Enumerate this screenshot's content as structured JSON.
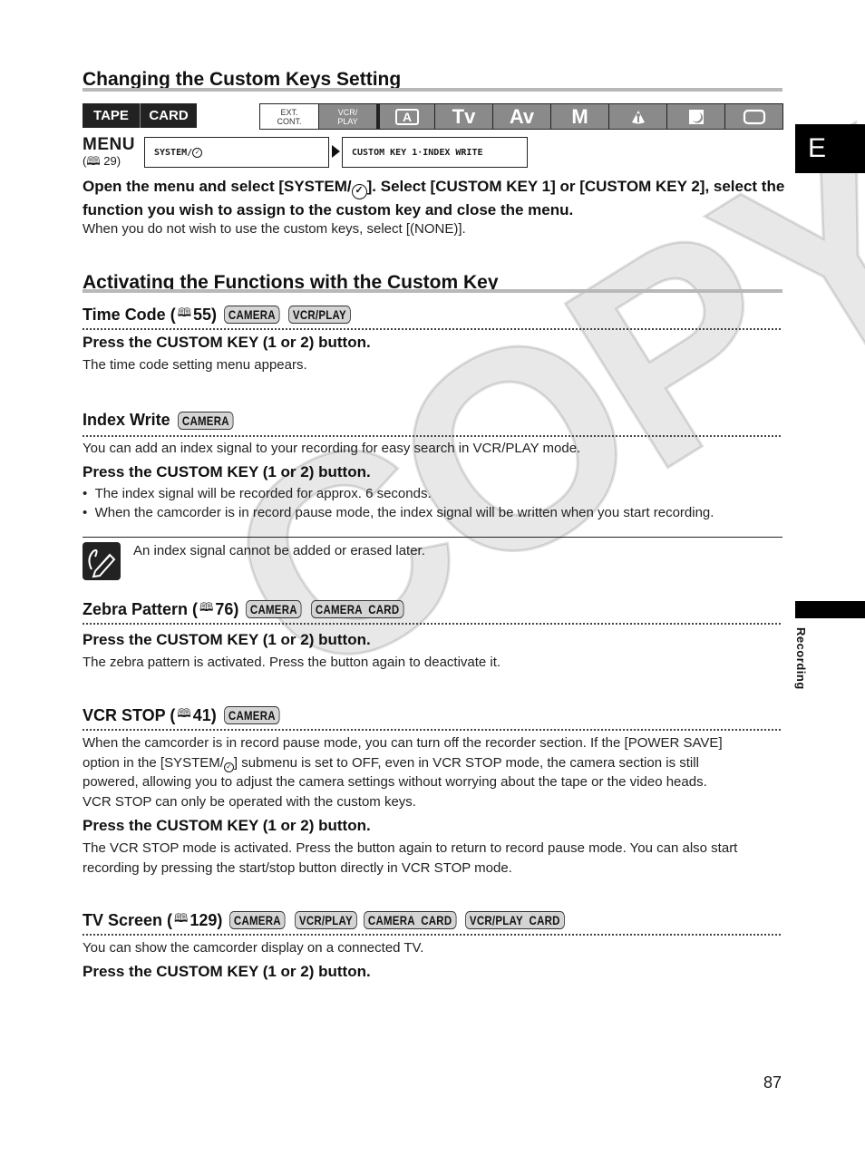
{
  "section1": {
    "title": "Changing the Custom Keys Setting",
    "media_modes": [
      "TAPE",
      "CARD"
    ],
    "shooting_modes": [
      {
        "label": "EXT.\nCONT.",
        "name": "ext-cont",
        "active": true
      },
      {
        "label": "VCR/\nPLAY",
        "name": "vcr-play",
        "active": false
      },
      {
        "label": "A",
        "name": "auto",
        "active": false
      },
      {
        "label": "Tv",
        "name": "tv",
        "active": false
      },
      {
        "label": "Av",
        "name": "av",
        "active": false
      },
      {
        "label": "M",
        "name": "manual",
        "active": false
      },
      {
        "label": "spotlight",
        "name": "spotlight",
        "active": false
      },
      {
        "label": "night",
        "name": "night",
        "active": false
      },
      {
        "label": "scene",
        "name": "scene",
        "active": false
      }
    ],
    "menu_label": "MENU",
    "menu_ref": "29",
    "menu_path_1": "SYSTEM/",
    "menu_path_2": "CUSTOM KEY 1·INDEX WRITE",
    "instruction": "Open the menu and select [SYSTEM/",
    "instruction_2": "]. Select [CUSTOM KEY 1] or [CUSTOM KEY 2], select the function you wish to assign to the custom key and close the menu.",
    "note": "When you do not wish to use the custom keys, select [(NONE)]."
  },
  "section2": {
    "title": "Activating the Functions with the Custom Key",
    "time_code": {
      "title": "Time Code (",
      "ref": "55)",
      "badges": [
        "CAMERA",
        "VCR/PLAY"
      ],
      "press": "Press the CUSTOM KEY (1 or 2) button.",
      "text": "The time code setting menu appears."
    },
    "index_write": {
      "title": "Index Write",
      "badges": [
        "CAMERA"
      ],
      "intro": "You can add an index signal to your recording for easy search in VCR/PLAY mode.",
      "press": "Press the CUSTOM KEY (1 or 2) button.",
      "bullets": [
        "The index signal will be recorded for approx. 6 seconds.",
        "When the camcorder is in record pause mode, the index signal will be written when you start recording."
      ],
      "note": "An index signal cannot be added or erased later."
    },
    "zebra": {
      "title": "Zebra Pattern (",
      "ref": "76)",
      "badges": [
        "CAMERA",
        "CAMERA  CARD"
      ],
      "press": "Press the CUSTOM KEY (1 or 2) button.",
      "text": "The zebra pattern is activated. Press the button again to deactivate it."
    },
    "vcr_stop": {
      "title": "VCR STOP (",
      "ref": "41)",
      "badges": [
        "CAMERA"
      ],
      "intro_lines": [
        "When the camcorder is in record pause mode, you can turn off the recorder section. If the [POWER SAVE]",
        "option in the [SYSTEM/",
        "] submenu is set to OFF, even in VCR STOP mode, the camera section is still",
        "powered, allowing you to adjust the camera settings without worrying about the tape or the video heads.",
        "VCR STOP can only be operated with the custom keys."
      ],
      "press": "Press the CUSTOM KEY (1 or 2) button.",
      "text_lines": [
        "The VCR STOP mode is activated. Press the button again to return to record pause mode. You can also start",
        "recording by pressing the start/stop button directly in VCR STOP mode."
      ]
    },
    "tv_screen": {
      "title": "TV Screen (",
      "ref": "129)",
      "badges": [
        "CAMERA",
        "VCR/PLAY",
        "CAMERA  CARD",
        "VCR/PLAY  CARD"
      ],
      "intro": "You can show the camcorder display on a connected TV.",
      "press": "Press the CUSTOM KEY (1 or 2) button."
    }
  },
  "side_tab": {
    "letter": "E",
    "section": "Recording"
  },
  "page_number": "87",
  "watermark": "COPY",
  "icons": {
    "book": "📖",
    "check_circle": "✓"
  }
}
